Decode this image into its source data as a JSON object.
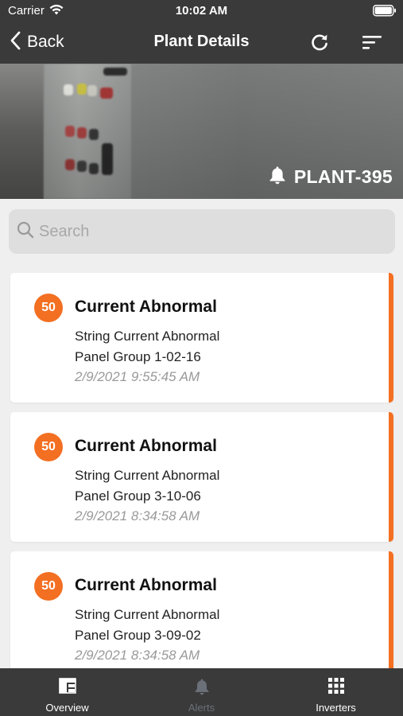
{
  "status_bar": {
    "carrier": "Carrier",
    "time": "10:02 AM"
  },
  "nav": {
    "back_label": "Back",
    "title": "Plant Details"
  },
  "plant": {
    "id": "PLANT-395"
  },
  "search": {
    "placeholder": "Search",
    "value": ""
  },
  "alerts": [
    {
      "severity": "50",
      "title": "Current Abnormal",
      "description": "String Current Abnormal",
      "location": "Panel Group 1-02-16",
      "timestamp": "2/9/2021 9:55:45 AM"
    },
    {
      "severity": "50",
      "title": "Current Abnormal",
      "description": "String Current Abnormal",
      "location": "Panel Group 3-10-06",
      "timestamp": "2/9/2021 8:34:58 AM"
    },
    {
      "severity": "50",
      "title": "Current Abnormal",
      "description": "String Current Abnormal",
      "location": "Panel Group 3-09-02",
      "timestamp": "2/9/2021 8:34:58 AM"
    }
  ],
  "tabs": [
    {
      "label": "Overview",
      "icon": "dashboard-icon"
    },
    {
      "label": "Alerts",
      "icon": "bell-icon",
      "active": true
    },
    {
      "label": "Inverters",
      "icon": "grid-icon"
    }
  ],
  "colors": {
    "bar_background": "#3a3a3a",
    "alert_accent": "#f36f22",
    "page_background": "#efefef",
    "inactive_tab": "#6b7079"
  }
}
